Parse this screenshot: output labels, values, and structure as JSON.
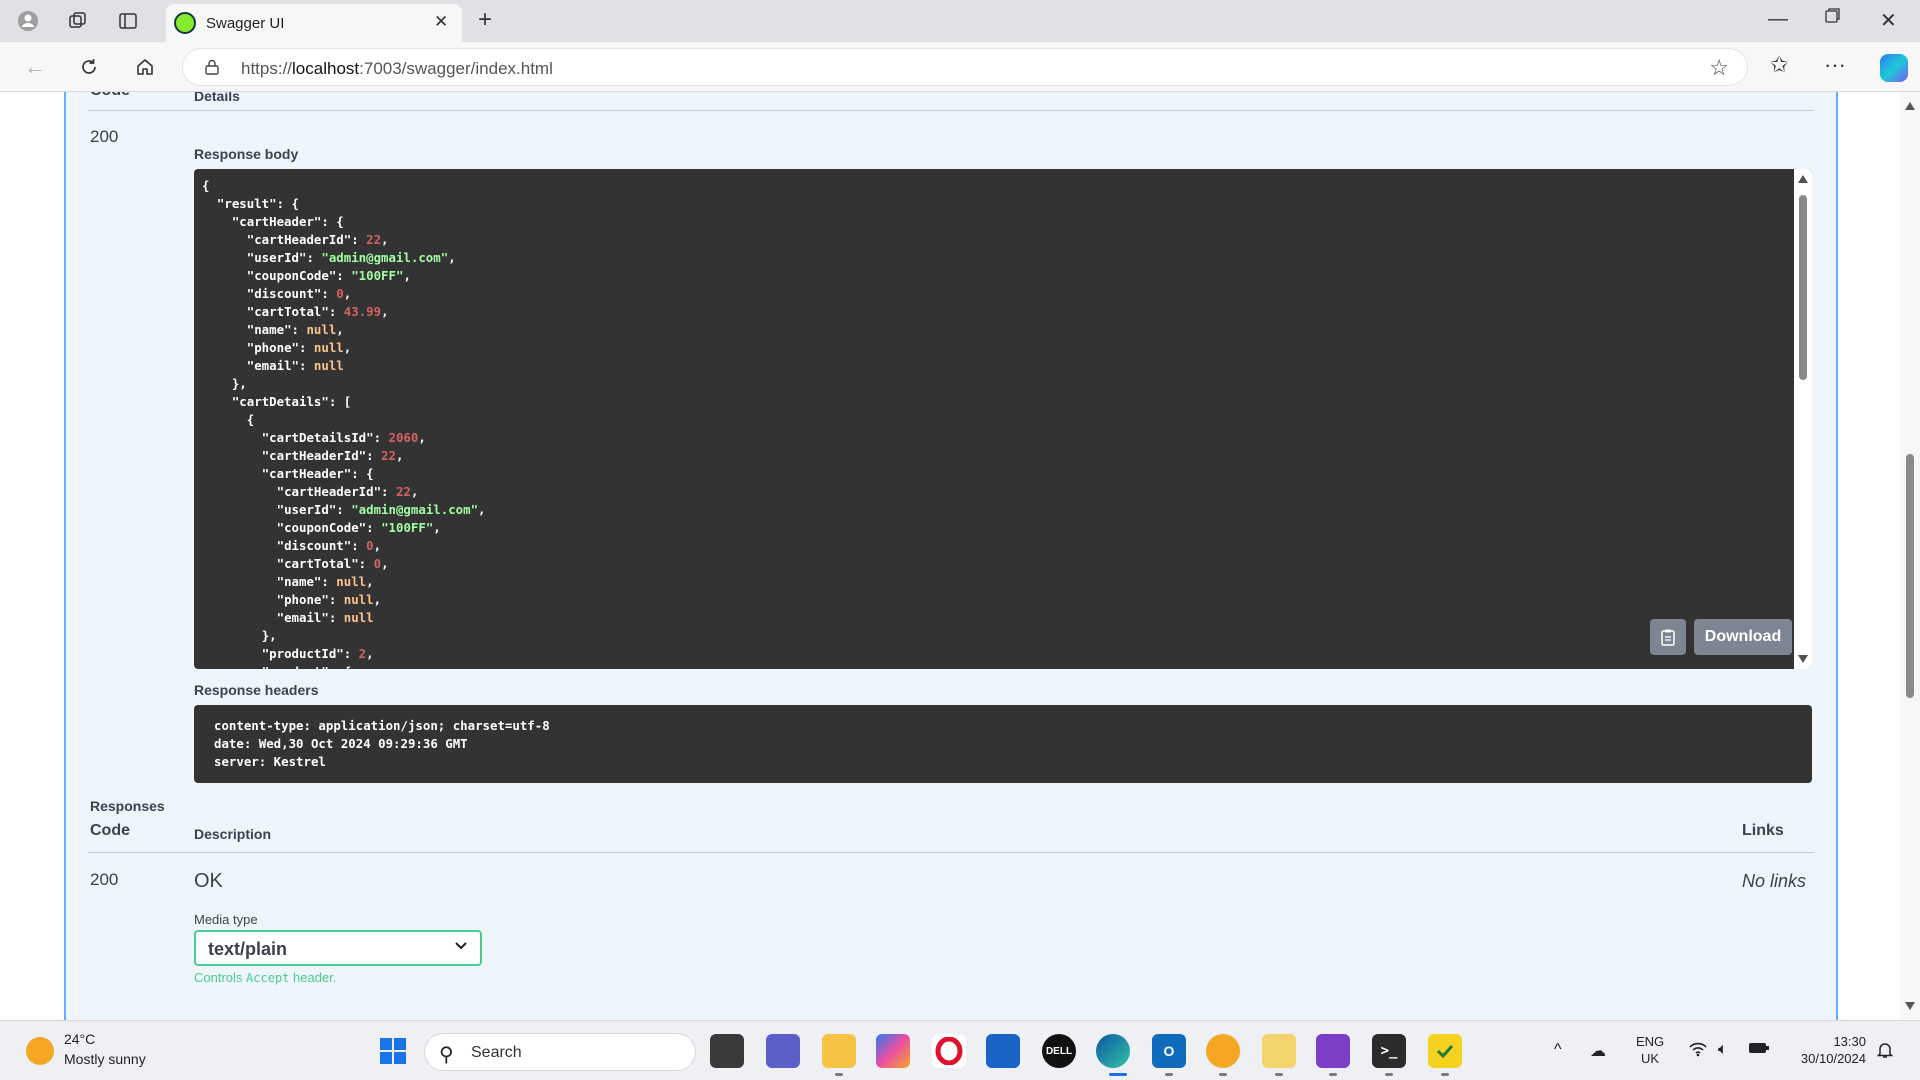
{
  "browser": {
    "tab_title": "Swagger UI",
    "url_prefix": "https://",
    "url_host": "localhost",
    "url_path": ":7003/swagger/index.html"
  },
  "response": {
    "header_code": "Code",
    "header_details": "Details",
    "code": "200",
    "body_label": "Response body",
    "download_label": "Download",
    "headers_label": "Response headers",
    "headers": [
      "content-type: application/json; charset=utf-8",
      "date: Wed,30 Oct 2024 09:29:36 GMT",
      "server: Kestrel"
    ],
    "body_lines": [
      {
        "i": 0,
        "parts": [
          [
            "p",
            "{"
          ]
        ]
      },
      {
        "i": 1,
        "parts": [
          [
            "k",
            "\"result\""
          ],
          [
            "p",
            ": {"
          ]
        ]
      },
      {
        "i": 2,
        "parts": [
          [
            "k",
            "\"cartHeader\""
          ],
          [
            "p",
            ": {"
          ]
        ]
      },
      {
        "i": 3,
        "parts": [
          [
            "k",
            "\"cartHeaderId\""
          ],
          [
            "p",
            ": "
          ],
          [
            "n",
            "22"
          ],
          [
            "p",
            ","
          ]
        ]
      },
      {
        "i": 3,
        "parts": [
          [
            "k",
            "\"userId\""
          ],
          [
            "p",
            ": "
          ],
          [
            "s",
            "\"admin@gmail.com\""
          ],
          [
            "p",
            ","
          ]
        ]
      },
      {
        "i": 3,
        "parts": [
          [
            "k",
            "\"couponCode\""
          ],
          [
            "p",
            ": "
          ],
          [
            "s",
            "\"100FF\""
          ],
          [
            "p",
            ","
          ]
        ]
      },
      {
        "i": 3,
        "parts": [
          [
            "k",
            "\"discount\""
          ],
          [
            "p",
            ": "
          ],
          [
            "n",
            "0"
          ],
          [
            "p",
            ","
          ]
        ]
      },
      {
        "i": 3,
        "parts": [
          [
            "k",
            "\"cartTotal\""
          ],
          [
            "p",
            ": "
          ],
          [
            "n",
            "43.99"
          ],
          [
            "p",
            ","
          ]
        ]
      },
      {
        "i": 3,
        "parts": [
          [
            "k",
            "\"name\""
          ],
          [
            "p",
            ": "
          ],
          [
            "l",
            "null"
          ],
          [
            "p",
            ","
          ]
        ]
      },
      {
        "i": 3,
        "parts": [
          [
            "k",
            "\"phone\""
          ],
          [
            "p",
            ": "
          ],
          [
            "l",
            "null"
          ],
          [
            "p",
            ","
          ]
        ]
      },
      {
        "i": 3,
        "parts": [
          [
            "k",
            "\"email\""
          ],
          [
            "p",
            ": "
          ],
          [
            "l",
            "null"
          ]
        ]
      },
      {
        "i": 2,
        "parts": [
          [
            "p",
            "},"
          ]
        ]
      },
      {
        "i": 2,
        "parts": [
          [
            "k",
            "\"cartDetails\""
          ],
          [
            "p",
            ": ["
          ]
        ]
      },
      {
        "i": 3,
        "parts": [
          [
            "p",
            "{"
          ]
        ]
      },
      {
        "i": 4,
        "parts": [
          [
            "k",
            "\"cartDetailsId\""
          ],
          [
            "p",
            ": "
          ],
          [
            "n",
            "2060"
          ],
          [
            "p",
            ","
          ]
        ]
      },
      {
        "i": 4,
        "parts": [
          [
            "k",
            "\"cartHeaderId\""
          ],
          [
            "p",
            ": "
          ],
          [
            "n",
            "22"
          ],
          [
            "p",
            ","
          ]
        ]
      },
      {
        "i": 4,
        "parts": [
          [
            "k",
            "\"cartHeader\""
          ],
          [
            "p",
            ": {"
          ]
        ]
      },
      {
        "i": 5,
        "parts": [
          [
            "k",
            "\"cartHeaderId\""
          ],
          [
            "p",
            ": "
          ],
          [
            "n",
            "22"
          ],
          [
            "p",
            ","
          ]
        ]
      },
      {
        "i": 5,
        "parts": [
          [
            "k",
            "\"userId\""
          ],
          [
            "p",
            ": "
          ],
          [
            "s",
            "\"admin@gmail.com\""
          ],
          [
            "p",
            ","
          ]
        ]
      },
      {
        "i": 5,
        "parts": [
          [
            "k",
            "\"couponCode\""
          ],
          [
            "p",
            ": "
          ],
          [
            "s",
            "\"100FF\""
          ],
          [
            "p",
            ","
          ]
        ]
      },
      {
        "i": 5,
        "parts": [
          [
            "k",
            "\"discount\""
          ],
          [
            "p",
            ": "
          ],
          [
            "n",
            "0"
          ],
          [
            "p",
            ","
          ]
        ]
      },
      {
        "i": 5,
        "parts": [
          [
            "k",
            "\"cartTotal\""
          ],
          [
            "p",
            ": "
          ],
          [
            "n",
            "0"
          ],
          [
            "p",
            ","
          ]
        ]
      },
      {
        "i": 5,
        "parts": [
          [
            "k",
            "\"name\""
          ],
          [
            "p",
            ": "
          ],
          [
            "l",
            "null"
          ],
          [
            "p",
            ","
          ]
        ]
      },
      {
        "i": 5,
        "parts": [
          [
            "k",
            "\"phone\""
          ],
          [
            "p",
            ": "
          ],
          [
            "l",
            "null"
          ],
          [
            "p",
            ","
          ]
        ]
      },
      {
        "i": 5,
        "parts": [
          [
            "k",
            "\"email\""
          ],
          [
            "p",
            ": "
          ],
          [
            "l",
            "null"
          ]
        ]
      },
      {
        "i": 4,
        "parts": [
          [
            "p",
            "},"
          ]
        ]
      },
      {
        "i": 4,
        "parts": [
          [
            "k",
            "\"productId\""
          ],
          [
            "p",
            ": "
          ],
          [
            "n",
            "2"
          ],
          [
            "p",
            ","
          ]
        ]
      },
      {
        "i": 4,
        "parts": [
          [
            "k",
            "\"product\""
          ],
          [
            "p",
            ": {"
          ]
        ]
      }
    ]
  },
  "responses": {
    "title": "Responses",
    "col_code": "Code",
    "col_description": "Description",
    "col_links": "Links",
    "row_code": "200",
    "row_description": "OK",
    "row_links": "No links",
    "media_type_label": "Media type",
    "media_type_value": "text/plain",
    "controls_prefix": "Controls",
    "controls_code": "Accept",
    "controls_suffix": "header."
  },
  "taskbar": {
    "temperature": "24°C",
    "weather": "Mostly sunny",
    "search_label": "Search",
    "lang_top": "ENG",
    "lang_bottom": "UK",
    "time": "13:30",
    "date": "30/10/2024"
  },
  "colors": {
    "get_blue": "#61affe",
    "code_bg": "#333333",
    "select_green": "#49cc90",
    "number": "#d36363",
    "string": "#a2fca2",
    "null": "#fcc28c"
  }
}
